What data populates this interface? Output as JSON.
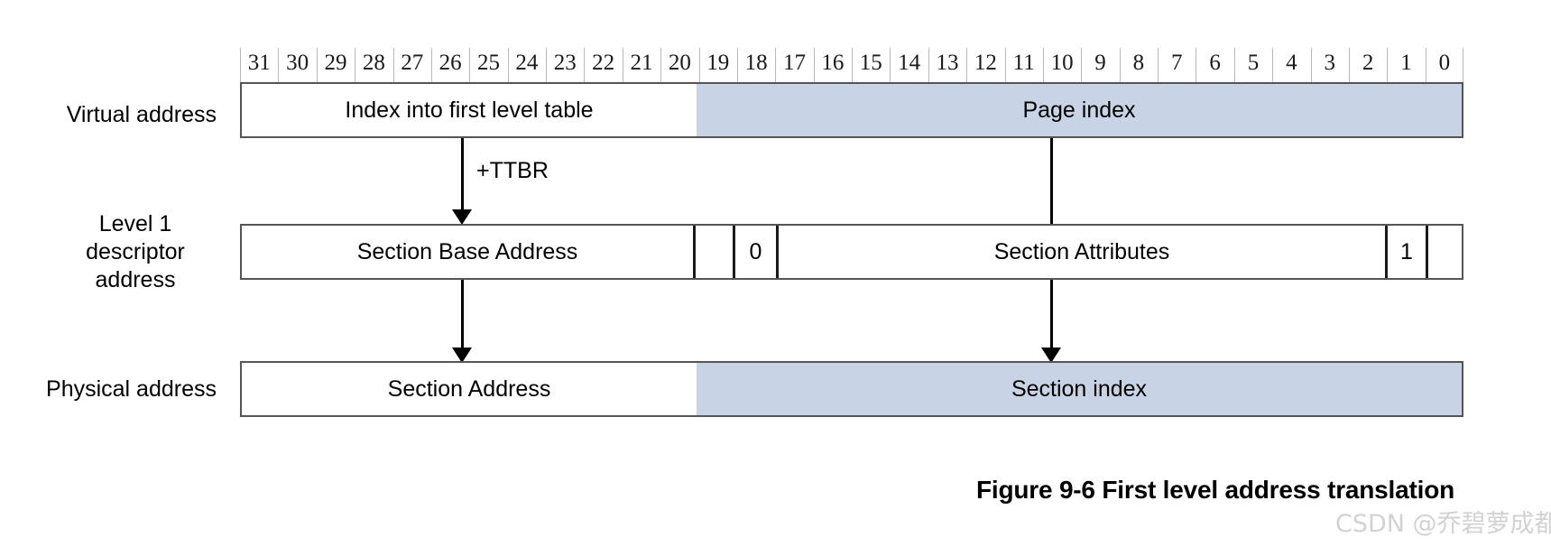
{
  "figure": {
    "caption": "Figure 9-6 First level address translation",
    "watermark": "CSDN @乔碧萝成都分萝"
  },
  "colors": {
    "shaded_field": "#c8d4e6",
    "bar_border": "#555555",
    "divider": "#1a1a1a",
    "arrow": "#000000",
    "ruler_tick": "#b9b9b9",
    "watermark": "#d2d2d2"
  },
  "bit_ruler": {
    "bits": [
      "31",
      "30",
      "29",
      "28",
      "27",
      "26",
      "25",
      "24",
      "23",
      "22",
      "21",
      "20",
      "19",
      "18",
      "17",
      "16",
      "15",
      "14",
      "13",
      "12",
      "11",
      "10",
      "9",
      "8",
      "7",
      "6",
      "5",
      "4",
      "3",
      "2",
      "1",
      "0"
    ],
    "msb": 31,
    "lsb": 0
  },
  "rows": [
    {
      "id": "virtual-address",
      "label": "Virtual address",
      "label_lines": [
        "Virtual address"
      ],
      "fields": [
        {
          "name": "index-into-first-level-table",
          "text": "Index into first level table",
          "bits_high": 31,
          "bits_low": 20,
          "shaded": false
        },
        {
          "name": "page-index",
          "text": "Page index",
          "bits_high": 19,
          "bits_low": 0,
          "shaded": true
        }
      ]
    },
    {
      "id": "level-1-descriptor-address",
      "label": "Level 1 descriptor address",
      "label_lines": [
        "Level 1",
        "descriptor",
        "address"
      ],
      "fields": [
        {
          "name": "section-base-address",
          "text": "Section Base Address",
          "shaded": false
        },
        {
          "name": "reserved-cell-a",
          "text": "",
          "shaded": false
        },
        {
          "name": "zero-bit-cell",
          "text": "0",
          "shaded": false
        },
        {
          "name": "section-attributes",
          "text": "Section Attributes",
          "shaded": false
        },
        {
          "name": "one-bit-cell",
          "text": "1",
          "shaded": false
        },
        {
          "name": "reserved-cell-b",
          "text": "",
          "shaded": false
        }
      ]
    },
    {
      "id": "physical-address",
      "label": "Physical address",
      "label_lines": [
        "Physical address"
      ],
      "fields": [
        {
          "name": "section-address",
          "text": "Section Address",
          "bits_high": 31,
          "bits_low": 20,
          "shaded": false
        },
        {
          "name": "section-index",
          "text": "Section index",
          "bits_high": 19,
          "bits_low": 0,
          "shaded": true
        }
      ]
    }
  ],
  "annotations": [
    {
      "name": "ttbr-offset",
      "text": "+TTBR"
    }
  ],
  "arrows": [
    {
      "name": "index-to-descriptor-arrow",
      "from": "index-into-first-level-table",
      "to": "level-1-descriptor-address"
    },
    {
      "name": "descriptor-to-section-address-arrow",
      "from": "level-1-descriptor-address",
      "to": "section-address"
    },
    {
      "name": "page-index-to-section-index-arrow",
      "from": "page-index",
      "to": "section-index"
    }
  ]
}
